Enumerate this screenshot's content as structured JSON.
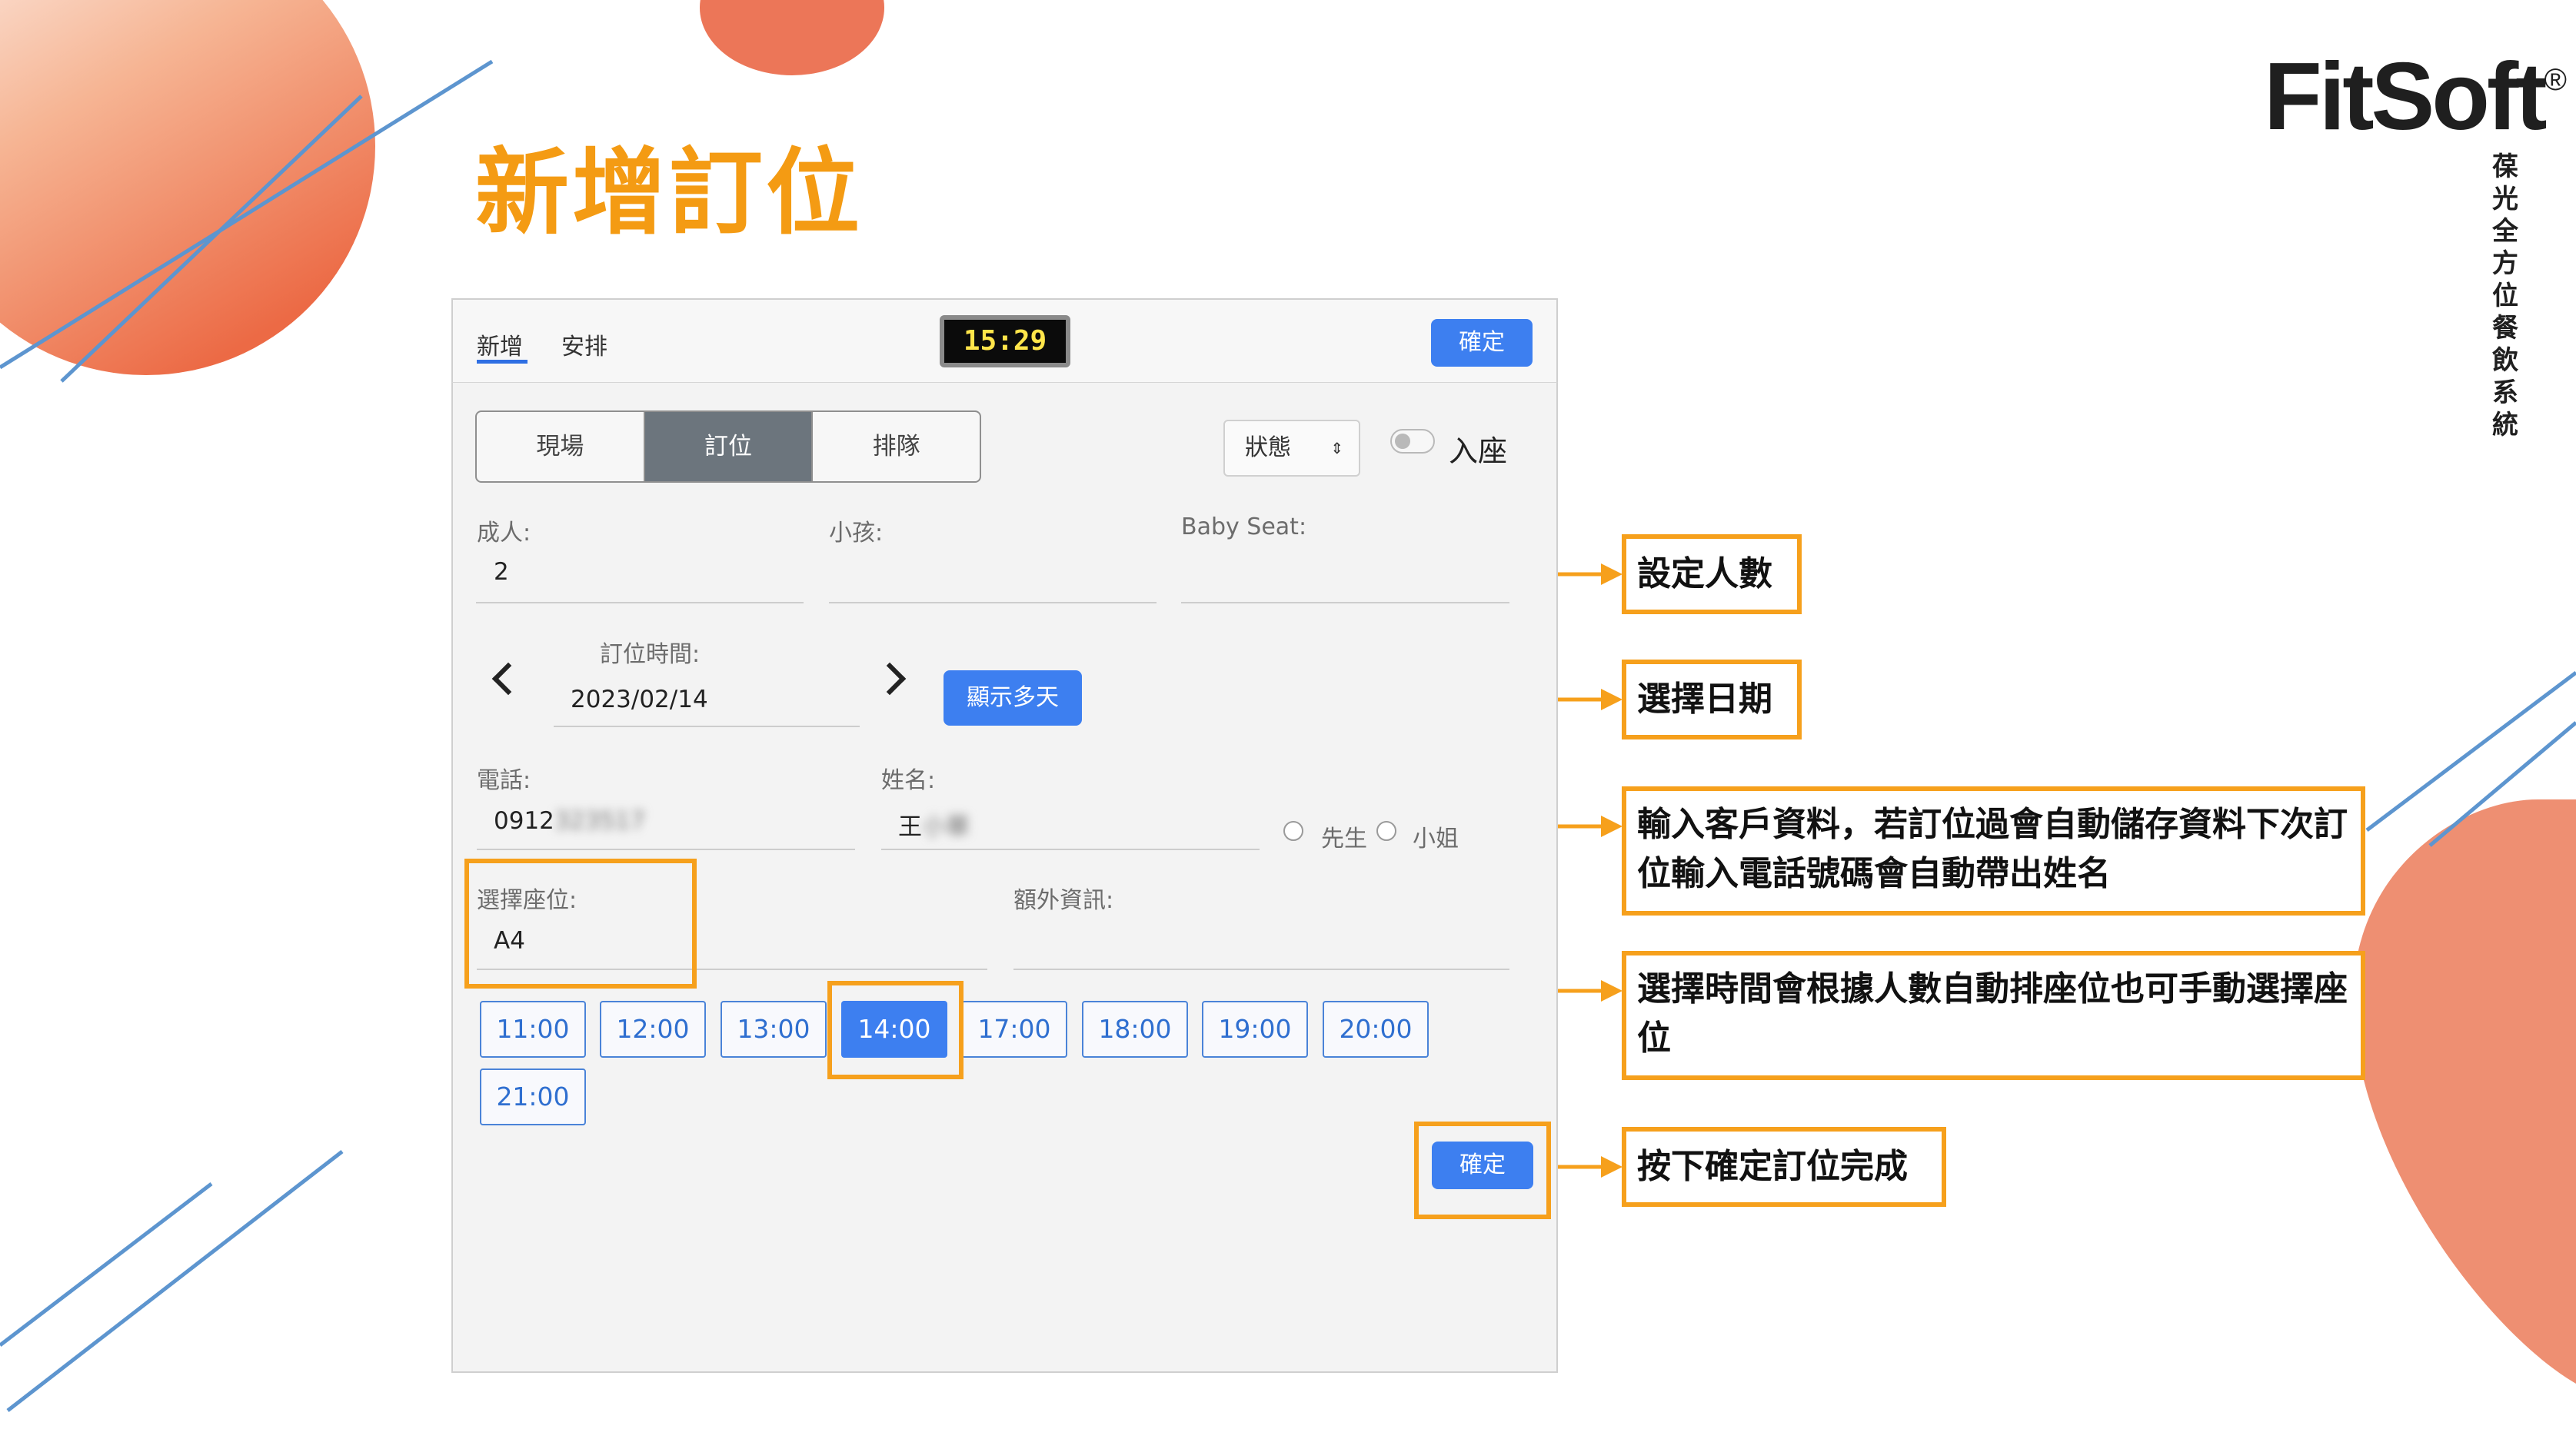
{
  "slide": {
    "title": "新增訂位",
    "brand_name": "FitSoft",
    "brand_mark": "®",
    "brand_subtitle": "葆光全方位餐飲系統"
  },
  "app": {
    "tabs": [
      "新增",
      "安排"
    ],
    "active_tab": "新增",
    "clock": "15:29",
    "confirm_label": "確定",
    "mode_segments": [
      "現場",
      "訂位",
      "排隊"
    ],
    "active_segment": "訂位",
    "status_select": "狀態",
    "seated_toggle_label": "入座",
    "seated_toggle_on": false,
    "adults": {
      "label": "成人:",
      "value": "2"
    },
    "children": {
      "label": "小孩:",
      "value": ""
    },
    "baby_seat": {
      "label": "Baby Seat:",
      "value": ""
    },
    "booking_time": {
      "label": "訂位時間:",
      "date": "2023/02/14"
    },
    "show_days_button": "顯示多天",
    "phone": {
      "label": "電話:",
      "visible_prefix": "0912",
      "masked": "323517"
    },
    "name": {
      "label": "姓名:",
      "visible_prefix": "王",
      "masked": "小華"
    },
    "salutation_options": [
      "先生",
      "小姐"
    ],
    "seat": {
      "label": "選擇座位:",
      "value": "A4"
    },
    "extra_info": {
      "label": "額外資訊:",
      "value": ""
    },
    "time_slots": [
      "11:00",
      "12:00",
      "13:00",
      "14:00",
      "17:00",
      "18:00",
      "19:00",
      "20:00",
      "21:00"
    ],
    "selected_time": "14:00",
    "bottom_confirm_label": "確定"
  },
  "annotations": [
    "設定人數",
    "選擇日期",
    "輸入客戶資料，若訂位過會自動儲存資料下次訂位輸入電話號碼會自動帶出姓名",
    "選擇時間會根據人數自動排座位也可手動選擇座位",
    "按下確定訂位完成"
  ],
  "colors": {
    "accent_orange": "#f49b13",
    "button_blue": "#3d7ff0",
    "decor_salmon": "#ee8a6c",
    "decor_line_blue": "#5d95cf"
  }
}
